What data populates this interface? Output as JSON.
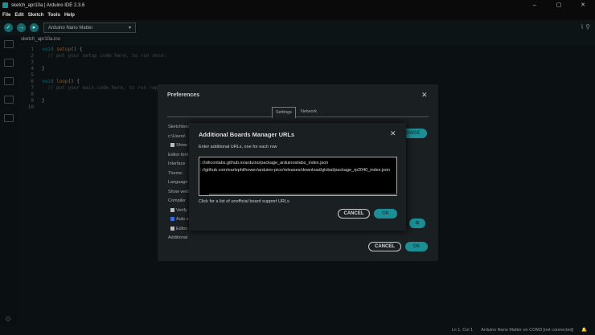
{
  "window": {
    "title": "sketch_apr10a | Arduino IDE 2.3.6",
    "min": "–",
    "max": "▢",
    "close": "✕"
  },
  "menu": [
    "File",
    "Edit",
    "Sketch",
    "Tools",
    "Help"
  ],
  "toolbar": {
    "verify": "✓",
    "upload": "→",
    "debug": "▸",
    "board": "Arduino Nano Matter",
    "caret": "▾",
    "plotter": "⌇",
    "monitor": "⚲"
  },
  "tab": "sketch_apr10a.ino",
  "code": [
    {
      "n": "1",
      "kw": "void",
      "fn": "setup",
      "rest": "() {"
    },
    {
      "n": "2",
      "cm": "  // put your setup code here, to run once:"
    },
    {
      "n": "3"
    },
    {
      "n": "4",
      "tx": "}"
    },
    {
      "n": "5"
    },
    {
      "n": "6",
      "kw": "void",
      "fn": "loop",
      "rest": "() {"
    },
    {
      "n": "7",
      "cm": "  // put your main code here, to run repeat"
    },
    {
      "n": "8"
    },
    {
      "n": "9",
      "tx": "}"
    },
    {
      "n": "10"
    }
  ],
  "preferences": {
    "title": "Preferences",
    "tabs": [
      "Settings",
      "Network"
    ],
    "labels": [
      "Sketchbook",
      "c:\\Users\\",
      "Show",
      "Editor font",
      "Interface",
      "Theme:",
      "Language",
      "Show verb",
      "Compiler",
      "Verify",
      "Auto s",
      "Editor",
      "Additional"
    ],
    "browse": "OWSE",
    "cancel": "CANCEL",
    "ok": "OK"
  },
  "abm": {
    "title": "Additional Boards Manager URLs",
    "desc": "Enter additional URLs, one for each row",
    "urls": ":://siliconlabs.github.io/arduino/package_arduinosilabs_index.json\n:://github.com/earlephilhower/arduino-pico/releases/download/global/package_rp2040_index.json",
    "link": "Click for a list of unofficial board support URLs",
    "cancel": "CANCEL",
    "ok": "OK"
  },
  "status": {
    "position": "Ln 1, Col 1",
    "board": "Arduino Nano Matter on COM3 [not connected]",
    "bell": "🔔"
  }
}
